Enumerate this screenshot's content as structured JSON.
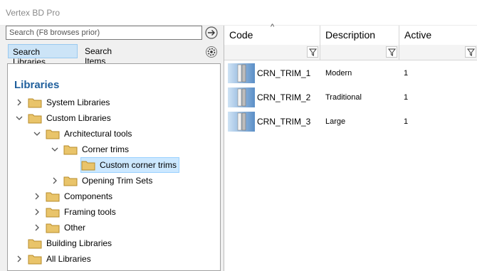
{
  "app": {
    "title": "Vertex BD Pro"
  },
  "search": {
    "placeholder": "Search (F8 browses prior)",
    "value": ""
  },
  "tabs": {
    "search_libraries": "Search Libraries",
    "search_items": "Search Items"
  },
  "tree": {
    "heading": "Libraries",
    "nodes": [
      {
        "label": "System Libraries",
        "chevron": "right"
      },
      {
        "label": "Custom Libraries",
        "chevron": "down"
      },
      {
        "label": "Architectural tools",
        "chevron": "down"
      },
      {
        "label": "Corner trims",
        "chevron": "down"
      },
      {
        "label": "Custom corner trims",
        "chevron": "none",
        "selected": true
      },
      {
        "label": "Opening Trim Sets",
        "chevron": "right"
      },
      {
        "label": "Components",
        "chevron": "right"
      },
      {
        "label": "Framing tools",
        "chevron": "right"
      },
      {
        "label": "Other",
        "chevron": "right"
      },
      {
        "label": "Building Libraries",
        "chevron": "none"
      },
      {
        "label": "All Libraries",
        "chevron": "right"
      }
    ]
  },
  "grid": {
    "columns": [
      "Code",
      "Description",
      "Active"
    ],
    "sort_indicator": "^",
    "rows": [
      {
        "code": "CRN_TRIM_1",
        "description": "Modern",
        "active": "1"
      },
      {
        "code": "CRN_TRIM_2",
        "description": "Traditional",
        "active": "1"
      },
      {
        "code": "CRN_TRIM_3",
        "description": "Large",
        "active": "1"
      }
    ]
  },
  "icons": {
    "go": "arrow-right-icon",
    "settings": "gear-icon",
    "filter": "filter-icon",
    "folder": "folder-icon",
    "thumbnail": "trim-thumbnail-icon"
  },
  "colors": {
    "accent": "#1f5f9c",
    "tab_active": "#cce4f7",
    "selected_row": "#cce8ff",
    "folder": "#e9c46a"
  }
}
